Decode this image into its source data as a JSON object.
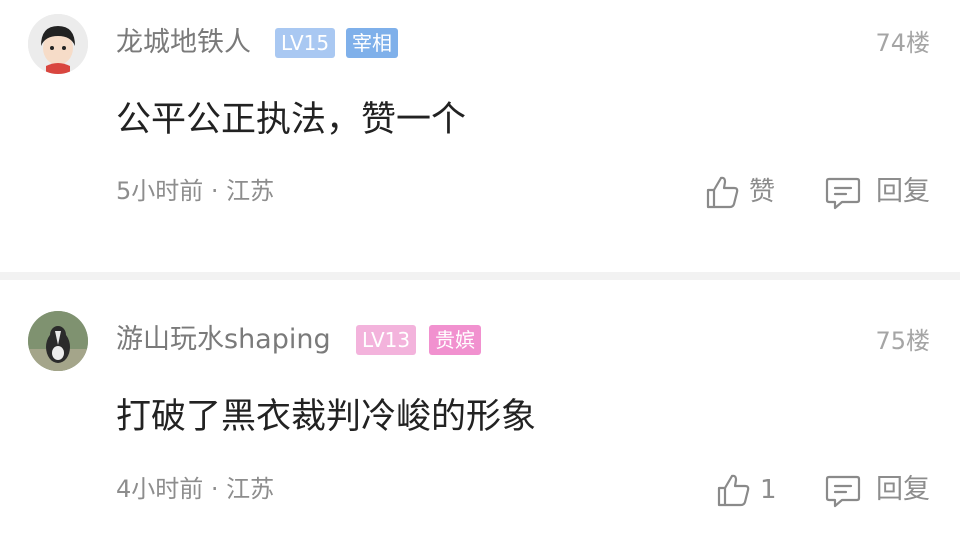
{
  "comments": [
    {
      "username": "龙城地铁人",
      "level": "LV15",
      "title_badge": "宰相",
      "floor": "74楼",
      "content": "公平公正执法，赞一个",
      "meta": "5小时前 · 江苏",
      "like_label": "赞",
      "reply_label": "回复",
      "avatar": "cartoon-girl-avatar",
      "colors": {
        "level": "#a9c8f2",
        "title": "#7fb0ea"
      }
    },
    {
      "username": "游山玩水shaping",
      "level": "LV13",
      "title_badge": "贵嫔",
      "floor": "75楼",
      "content": "打破了黑衣裁判冷峻的形象",
      "meta": "4小时前 · 江苏",
      "like_label": "1",
      "reply_label": "回复",
      "avatar": "dog-photo-avatar",
      "colors": {
        "level": "#f3b3dc",
        "title": "#f191cf"
      }
    }
  ],
  "icons": {
    "like": "thumbs-up-icon",
    "reply": "comment-bubble-icon"
  }
}
